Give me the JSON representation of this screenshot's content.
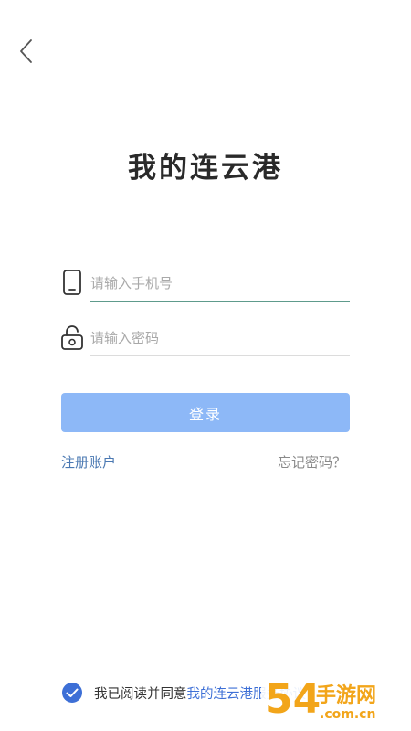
{
  "header": {
    "back_icon": "chevron-left-icon"
  },
  "app_title": "我的连云港",
  "form": {
    "phone": {
      "icon": "phone-icon",
      "placeholder": "请输入手机号",
      "value": ""
    },
    "password": {
      "icon": "lock-icon",
      "placeholder": "请输入密码",
      "value": ""
    },
    "login_label": "登录",
    "register_label": "注册账户",
    "forgot_label": "忘记密码？"
  },
  "agreement": {
    "checked": true,
    "prefix": "我已阅读并同意",
    "link_text": "我的连云港服务协议"
  },
  "watermark": {
    "number": "54",
    "text": "手游网",
    "domain": ".com.cn"
  },
  "colors": {
    "login_button": "#8db8f7",
    "link": "#4a78b2",
    "checkbox": "#3d6fd6",
    "watermark": "#f2a51a"
  }
}
